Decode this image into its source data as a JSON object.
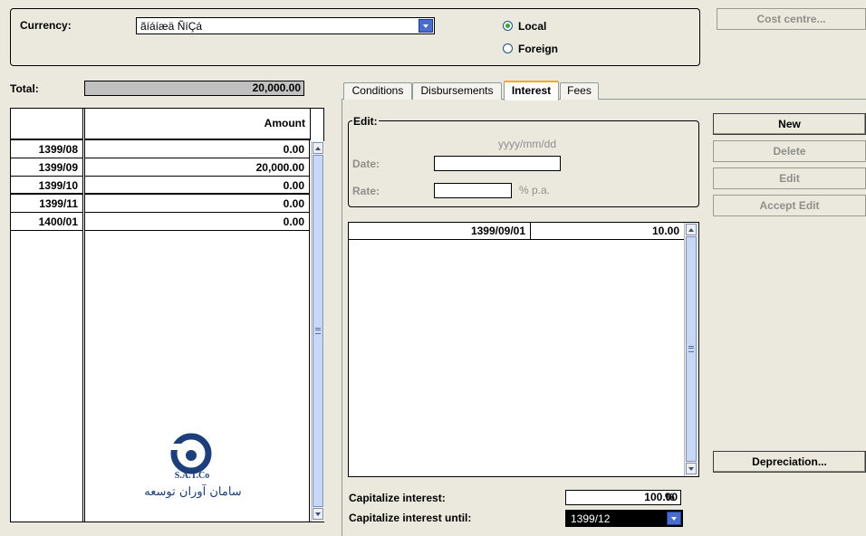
{
  "currency": {
    "label": "Currency:",
    "value": "ãíáíæä ÑíÇá",
    "options": {
      "local": "Local",
      "foreign": "Foreign",
      "selected": "local"
    }
  },
  "cost_centre_label": "Cost centre...",
  "total": {
    "label": "Total:",
    "value": "20,000.00"
  },
  "schedule": {
    "header_amount": "Amount",
    "rows": [
      {
        "period": "1399/08",
        "amount": "0.00"
      },
      {
        "period": "1399/09",
        "amount": "20,000.00"
      },
      {
        "period": "1399/10",
        "amount": "0.00"
      },
      {
        "period": "1399/11",
        "amount": "0.00"
      },
      {
        "period": "1400/01",
        "amount": "0.00"
      }
    ]
  },
  "logo": {
    "text": "S.A.T.Co",
    "persian": "سامان آوران توسعه"
  },
  "tabs": [
    {
      "label": "Conditions"
    },
    {
      "label": "Disbursements"
    },
    {
      "label": "Interest",
      "active": true
    },
    {
      "label": "Fees"
    }
  ],
  "edit": {
    "legend": "Edit:",
    "date_format": "yyyy/mm/dd",
    "date_label": "Date:",
    "date_value": "",
    "rate_label": "Rate:",
    "rate_value": "",
    "rate_unit": "% p.a."
  },
  "interest_rows": [
    {
      "date": "1399/09/01",
      "rate": "10.00"
    }
  ],
  "buttons": {
    "new": "New",
    "delete": "Delete",
    "edit": "Edit",
    "accept_edit": "Accept Edit",
    "depreciation": "Depreciation..."
  },
  "capitalize": {
    "interest_label": "Capitalize interest:",
    "interest_value": "100.00",
    "percent": "%",
    "until_label": "Capitalize interest until:",
    "until_value": "1399/12"
  }
}
